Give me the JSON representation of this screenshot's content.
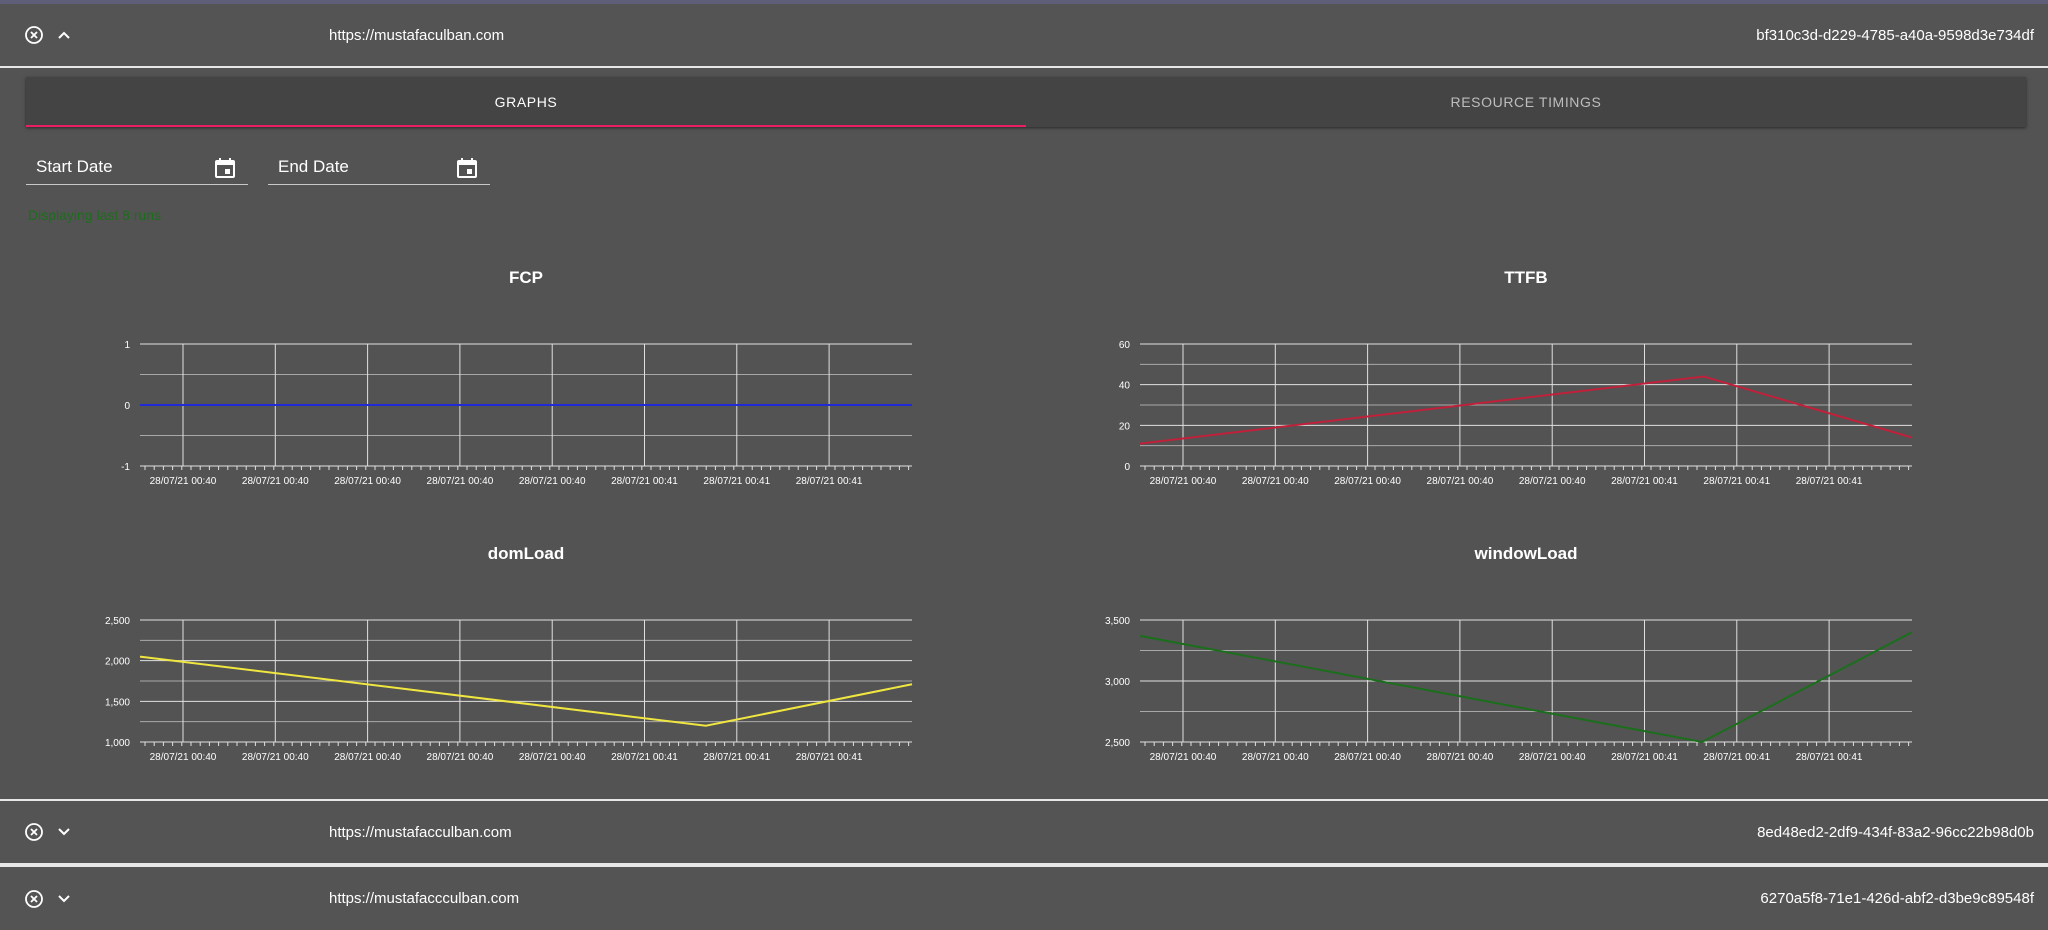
{
  "rows": [
    {
      "url": "https://mustafaculban.com",
      "id": "bf310c3d-d229-4785-a40a-9598d3e734df",
      "expanded": true
    },
    {
      "url": "https://mustafacculban.com",
      "id": "8ed48ed2-2df9-434f-83a2-96cc22b98d0b",
      "expanded": false
    },
    {
      "url": "https://mustafaccculban.com",
      "id": "6270a5f8-71e1-426d-abf2-d3be9c89548f",
      "expanded": false
    }
  ],
  "tabs": [
    {
      "label": "GRAPHS",
      "active": true
    },
    {
      "label": "RESOURCE TIMINGS",
      "active": false
    }
  ],
  "filters": {
    "start_date_label": "Start Date",
    "end_date_label": "End Date"
  },
  "status_message": "Displaying last 8 runs",
  "colors": {
    "accent": "#e91e63",
    "fcp": "#1f2bd6",
    "ttfb": "#c0203a",
    "domLoad": "#f0e640",
    "windowLoad": "#1b6e1b"
  },
  "chart_data": [
    {
      "type": "line",
      "title": "FCP",
      "x": [
        "28/07/21 00:40",
        "28/07/21 00:40",
        "28/07/21 00:40",
        "28/07/21 00:40",
        "28/07/21 00:40",
        "28/07/21 00:41",
        "28/07/21 00:41",
        "28/07/21 00:41"
      ],
      "series": [
        {
          "values": [
            0,
            0,
            0,
            0,
            0,
            0,
            0,
            0,
            0
          ]
        }
      ],
      "ylim": [
        -1,
        1
      ],
      "yticks": [
        "-1",
        "0",
        "1"
      ],
      "line_color": "#1f2bd6"
    },
    {
      "type": "line",
      "title": "TTFB",
      "x": [
        "28/07/21 00:40",
        "28/07/21 00:40",
        "28/07/21 00:40",
        "28/07/21 00:40",
        "28/07/21 00:40",
        "28/07/21 00:41",
        "28/07/21 00:41",
        "28/07/21 00:41"
      ],
      "series": [
        {
          "values": [
            11,
            44,
            14
          ]
        }
      ],
      "ylim": [
        0,
        60
      ],
      "yticks": [
        "0",
        "20",
        "40",
        "60"
      ],
      "line_color": "#c0203a"
    },
    {
      "type": "line",
      "title": "domLoad",
      "x": [
        "28/07/21 00:40",
        "28/07/21 00:40",
        "28/07/21 00:40",
        "28/07/21 00:40",
        "28/07/21 00:40",
        "28/07/21 00:41",
        "28/07/21 00:41",
        "28/07/21 00:41"
      ],
      "series": [
        {
          "values": [
            2050,
            1200,
            1710
          ]
        }
      ],
      "ylim": [
        1000,
        2500
      ],
      "yticks": [
        "1,000",
        "1,500",
        "2,000",
        "2,500"
      ],
      "line_color": "#f0e640"
    },
    {
      "type": "line",
      "title": "windowLoad",
      "x": [
        "28/07/21 00:40",
        "28/07/21 00:40",
        "28/07/21 00:40",
        "28/07/21 00:40",
        "28/07/21 00:40",
        "28/07/21 00:41",
        "28/07/21 00:41",
        "28/07/21 00:41"
      ],
      "series": [
        {
          "values": [
            3370,
            2500,
            3400
          ]
        }
      ],
      "ylim": [
        2500,
        3500
      ],
      "yticks": [
        "2,500",
        "3,000",
        "3,500"
      ],
      "line_color": "#1b6e1b"
    }
  ]
}
